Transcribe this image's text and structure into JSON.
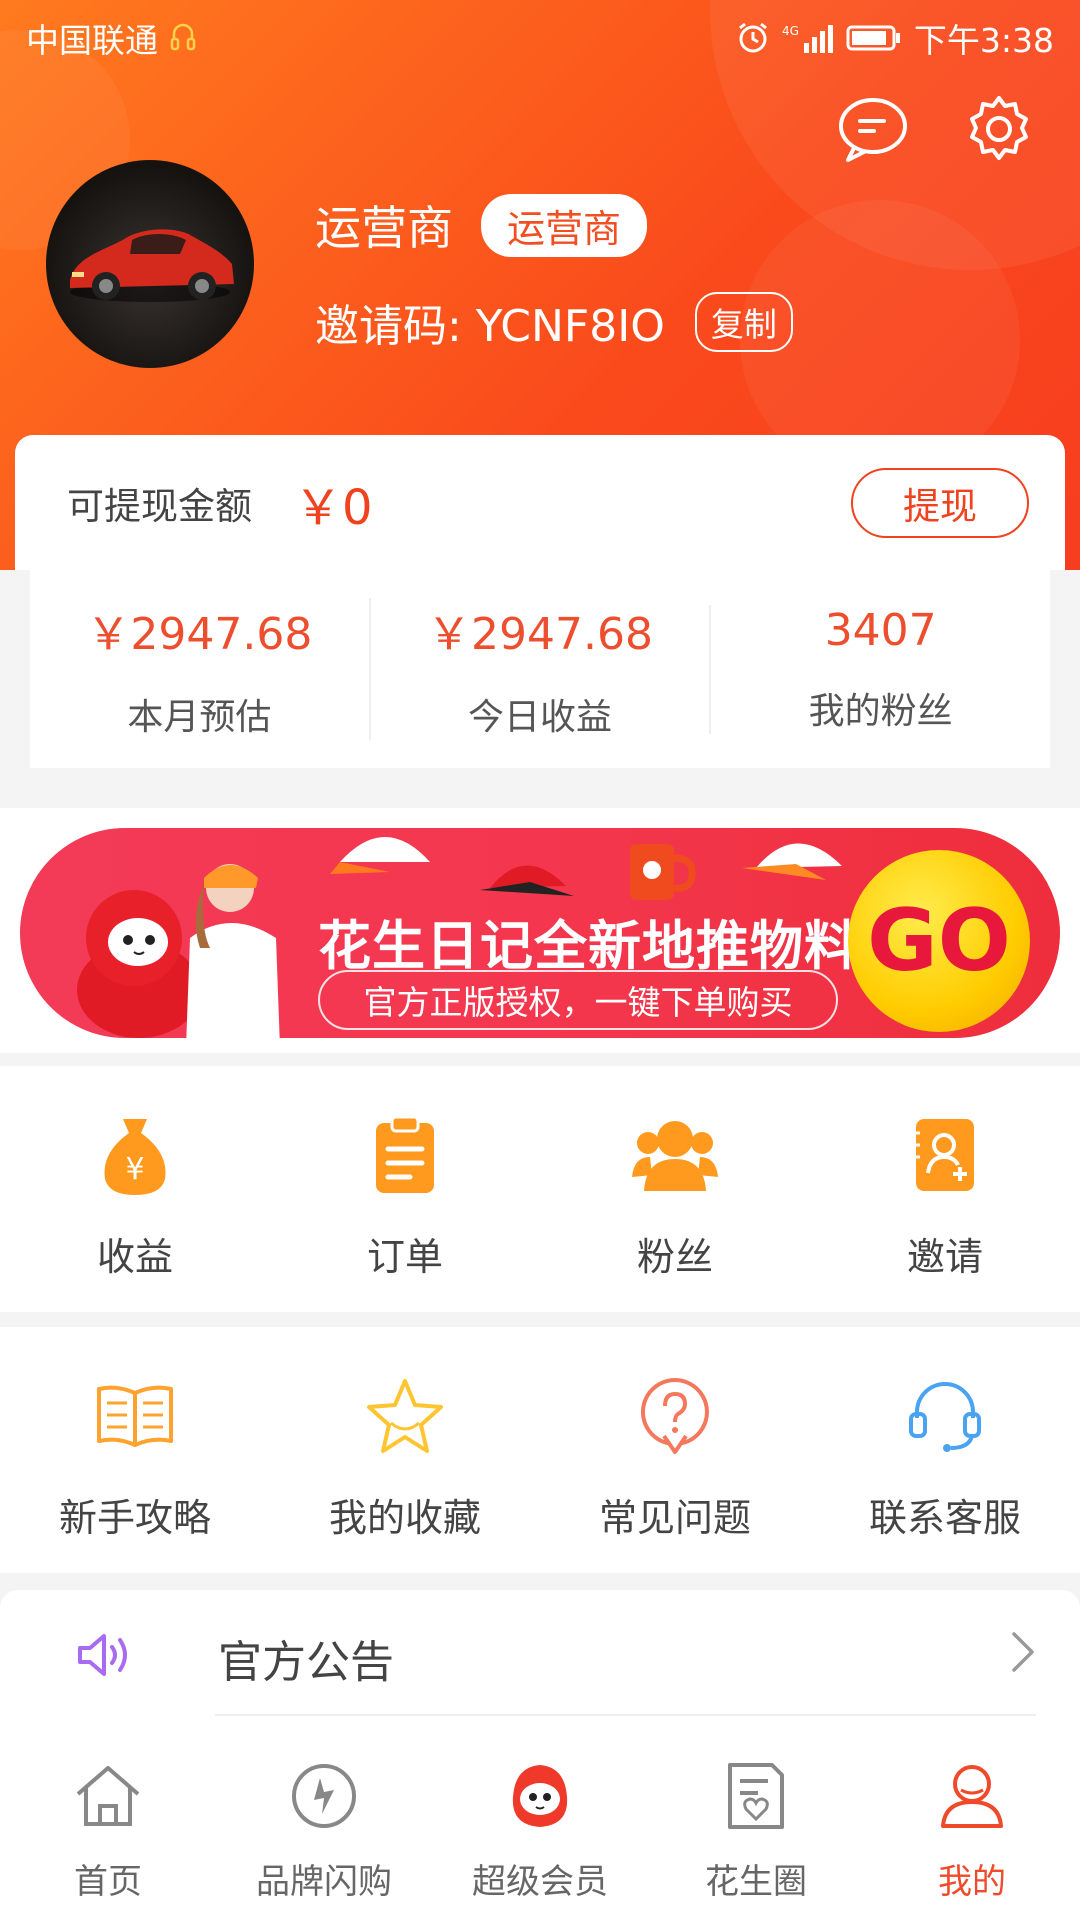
{
  "status_bar": {
    "carrier": "中国联通",
    "network": "4G",
    "time": "下午3:38"
  },
  "header": {
    "message_icon": "message-icon",
    "settings_icon": "gear-icon"
  },
  "user": {
    "name": "运营商",
    "role_badge": "运营商",
    "invite_label": "邀请码: YCNF8IO",
    "copy_label": "复制"
  },
  "balance": {
    "label": "可提现金额",
    "value": "￥0",
    "withdraw_label": "提现"
  },
  "stats": [
    {
      "value": "￥2947.68",
      "label": "本月预估"
    },
    {
      "value": "￥2947.68",
      "label": "今日收益"
    },
    {
      "value": "3407",
      "label": "我的粉丝"
    }
  ],
  "banner": {
    "title": "花生日记全新地推物料",
    "subtitle": "官方正版授权，一键下单购买",
    "go_label": "GO"
  },
  "grid_primary": [
    {
      "label": "收益",
      "icon": "money-bag-icon"
    },
    {
      "label": "订单",
      "icon": "clipboard-icon"
    },
    {
      "label": "粉丝",
      "icon": "fans-icon"
    },
    {
      "label": "邀请",
      "icon": "invite-icon"
    }
  ],
  "grid_secondary": [
    {
      "label": "新手攻略",
      "icon": "book-icon"
    },
    {
      "label": "我的收藏",
      "icon": "star-icon"
    },
    {
      "label": "常见问题",
      "icon": "question-icon"
    },
    {
      "label": "联系客服",
      "icon": "headset-icon"
    }
  ],
  "notice": {
    "title": "官方公告",
    "icon": "speaker-icon"
  },
  "tabs": [
    {
      "label": "首页",
      "icon": "home-icon"
    },
    {
      "label": "品牌闪购",
      "icon": "flash-icon"
    },
    {
      "label": "超级会员",
      "icon": "mascot-icon"
    },
    {
      "label": "花生圈",
      "icon": "circle-icon"
    },
    {
      "label": "我的",
      "icon": "profile-icon",
      "active": true
    }
  ],
  "colors": {
    "accent": "#f0421f",
    "header_start": "#ff7a1e",
    "header_end": "#f73d1f",
    "icon_orange": "#ff9a1f"
  }
}
